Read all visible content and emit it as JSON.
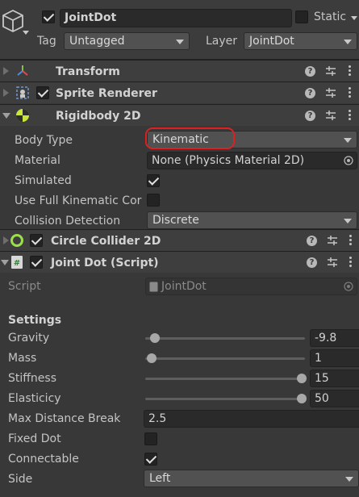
{
  "object": {
    "name": "JointDot",
    "static_label": "Static",
    "tag_label": "Tag",
    "tag_value": "Untagged",
    "layer_label": "Layer",
    "layer_value": "JointDot"
  },
  "components": {
    "transform": "Transform",
    "sprite_renderer": "Sprite Renderer",
    "rigidbody": "Rigidbody 2D",
    "circle_collider": "Circle Collider 2D",
    "joint_dot": "Joint Dot (Script)"
  },
  "rigidbody": {
    "body_type_label": "Body Type",
    "body_type_value": "Kinematic",
    "material_label": "Material",
    "material_value": "None (Physics Material 2D)",
    "simulated_label": "Simulated",
    "simulated_checked": true,
    "full_kinematic_label": "Use Full Kinematic Cor",
    "full_kinematic_checked": false,
    "collision_label": "Collision Detection",
    "collision_value": "Discrete"
  },
  "script": {
    "script_label": "Script",
    "script_value": "JointDot",
    "settings_header": "Settings",
    "gravity_label": "Gravity",
    "gravity_value": "-9.8",
    "gravity_level": 0.02,
    "mass_label": "Mass",
    "mass_value": "1",
    "mass_level": 0.0,
    "stiffness_label": "Stiffness",
    "stiffness_value": "15",
    "stiffness_level": 1.0,
    "elasticity_label": "Elasticicy",
    "elasticity_value": "50",
    "elasticity_level": 1.0,
    "max_distance_label": "Max Distance Break",
    "max_distance_value": "2.5",
    "fixed_label": "Fixed Dot",
    "fixed_checked": false,
    "connectable_label": "Connectable",
    "connectable_checked": true,
    "side_label": "Side",
    "side_value": "Left"
  },
  "colors": {
    "background": "#383838",
    "highlight_ring": "#e02020",
    "collider_icon": "#9be04a",
    "rigidbody_icon": "#c8e63c"
  },
  "icons": [
    "gameobject-cube-icon",
    "transform-axes-icon",
    "sprite-renderer-icon",
    "rigidbody-icon",
    "circle-collider-icon",
    "script-icon",
    "help-icon",
    "preset-icon",
    "kebab-menu-icon",
    "object-picker-icon"
  ]
}
